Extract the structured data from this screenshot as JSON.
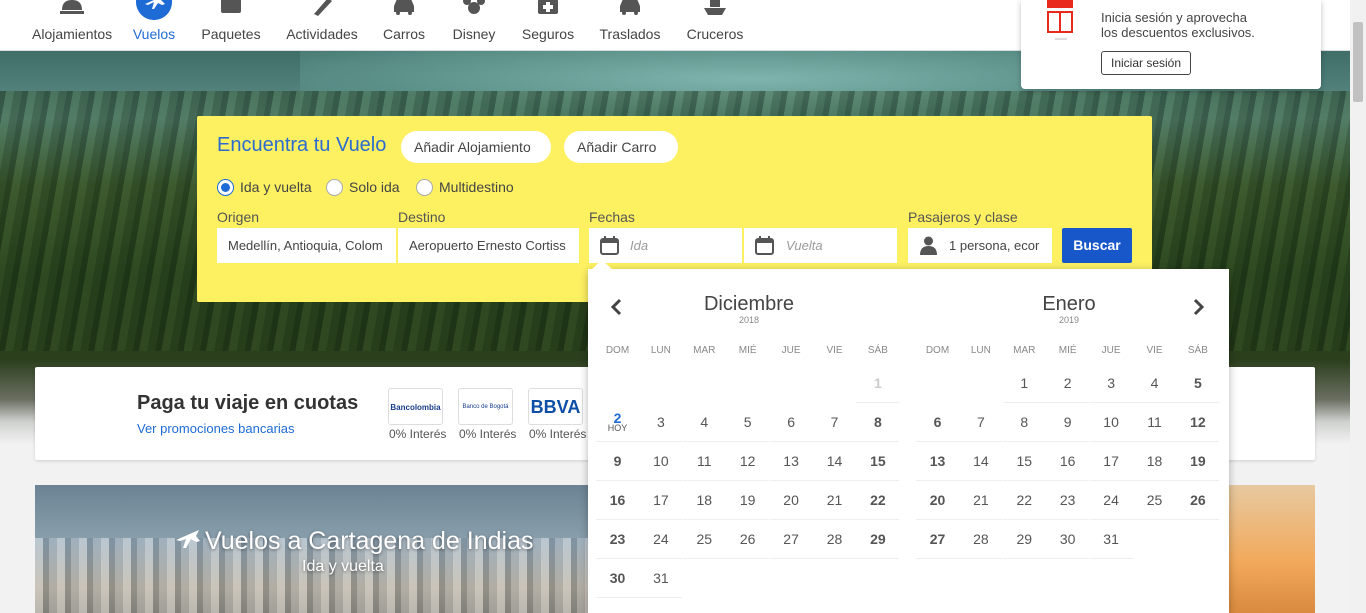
{
  "nav": {
    "items": [
      {
        "label": "Alojamientos",
        "icon": "hotel-bell-icon"
      },
      {
        "label": "Vuelos",
        "icon": "airplane-icon",
        "active": true
      },
      {
        "label": "Paquetes",
        "icon": "suitcase-icon"
      },
      {
        "label": "Actividades",
        "icon": "activities-icon"
      },
      {
        "label": "Carros",
        "icon": "car-icon"
      },
      {
        "label": "Disney",
        "icon": "disney-icon"
      },
      {
        "label": "Seguros",
        "icon": "medical-kit-icon"
      },
      {
        "label": "Traslados",
        "icon": "transfer-car-icon"
      },
      {
        "label": "Cruceros",
        "icon": "cruise-ship-icon"
      }
    ]
  },
  "promo": {
    "text_line1": "Inicia sesión y aprovecha",
    "text_line2": "los descuentos exclusivos.",
    "login_label": "Iniciar sesión"
  },
  "search": {
    "title": "Encuentra tu Vuelo",
    "add_hotel": "Añadir Alojamiento",
    "add_car": "Añadir Carro",
    "trip_types": [
      "Ida y vuelta",
      "Solo ida",
      "Multidestino"
    ],
    "selected_trip_type": "Ida y vuelta",
    "origin_label": "Origen",
    "origin_value": "Medellín, Antioquia, Colom",
    "destination_label": "Destino",
    "destination_value": "Aeropuerto Ernesto Cortiss",
    "dates_label": "Fechas",
    "depart_placeholder": "Ida",
    "return_placeholder": "Vuelta",
    "passengers_label": "Pasajeros y clase",
    "passengers_value": "1 persona, ecor",
    "search_button": "Buscar"
  },
  "cuotas": {
    "title": "Paga tu viaje en cuotas",
    "link": "Ver promociones bancarias",
    "banks": [
      {
        "name": "Bancolombia",
        "rate": "0% Interés"
      },
      {
        "name": "Banco de Bogotá",
        "rate": "0% Interés"
      },
      {
        "name": "BBVA",
        "rate": "0% Interés"
      }
    ]
  },
  "card": {
    "title": "Vuelos a Cartagena de Indias",
    "subtitle": "Ida y vuelta"
  },
  "calendar": {
    "dow": [
      "DOM",
      "LUN",
      "MAR",
      "MIÉ",
      "JUE",
      "VIE",
      "SÁB"
    ],
    "today_label": "HOY",
    "months": [
      {
        "name": "Diciembre",
        "year": "2018",
        "weeks": [
          [
            "",
            "",
            "",
            "",
            "",
            "",
            "1"
          ],
          [
            "2",
            "3",
            "4",
            "5",
            "6",
            "7",
            "8"
          ],
          [
            "9",
            "10",
            "11",
            "12",
            "13",
            "14",
            "15"
          ],
          [
            "16",
            "17",
            "18",
            "19",
            "20",
            "21",
            "22"
          ],
          [
            "23",
            "24",
            "25",
            "26",
            "27",
            "28",
            "29"
          ],
          [
            "30",
            "31",
            "",
            "",
            "",
            "",
            ""
          ]
        ],
        "disabled": [
          "1"
        ],
        "today": "2"
      },
      {
        "name": "Enero",
        "year": "2019",
        "weeks": [
          [
            "",
            "",
            "1",
            "2",
            "3",
            "4",
            "5"
          ],
          [
            "6",
            "7",
            "8",
            "9",
            "10",
            "11",
            "12"
          ],
          [
            "13",
            "14",
            "15",
            "16",
            "17",
            "18",
            "19"
          ],
          [
            "20",
            "21",
            "22",
            "23",
            "24",
            "25",
            "26"
          ],
          [
            "27",
            "28",
            "29",
            "30",
            "31",
            "",
            ""
          ]
        ],
        "disabled": [],
        "today": ""
      }
    ]
  },
  "colors": {
    "accent": "#1e6bd6",
    "search_bg": "#fdf162",
    "button": "#1857c9"
  }
}
